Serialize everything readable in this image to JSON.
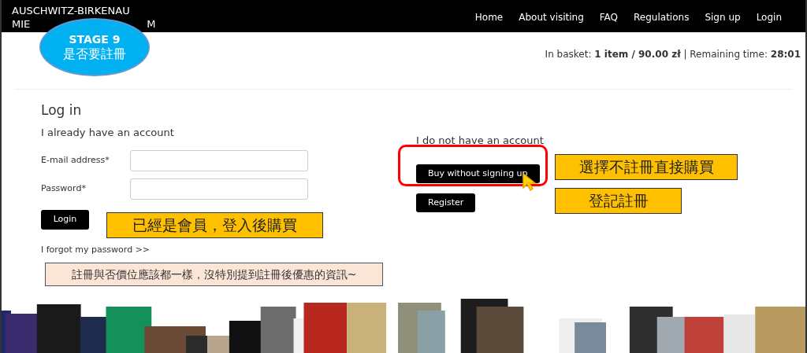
{
  "header": {
    "logo_line_1": "AUSCHWITZ-BIRKENAU",
    "logo_line_2_parts": [
      "MIE",
      "M"
    ],
    "nav": [
      {
        "label": "Home"
      },
      {
        "label": "About visiting"
      },
      {
        "label": "FAQ"
      },
      {
        "label": "Regulations"
      },
      {
        "label": "Sign up"
      },
      {
        "label": "Login"
      }
    ]
  },
  "basket": "In basket: **1 item / 90.00 zł** | Remaining time: **28:01**",
  "login": {
    "title": "Log in",
    "subtitle": "I already have an account",
    "fields": [
      {
        "label": "E-mail address*"
      },
      {
        "label": "Password*"
      }
    ],
    "button": "Login",
    "forgot_link": "I forgot my password >>"
  },
  "no_account": {
    "subtitle": "I do not have an account",
    "buttons": [
      "Buy without signing up",
      "Register"
    ]
  },
  "annotations": {
    "stage": {
      "title": "STAGE 9",
      "subtitle": "是否要註冊"
    },
    "login_note": "已經是會員，登入後購買",
    "guest_note": "選擇不註冊直接購買",
    "register_note": "登記註冊",
    "price_note": "註冊與否價位應該都一樣，沒特別提到註冊後優惠的資訊~"
  }
}
